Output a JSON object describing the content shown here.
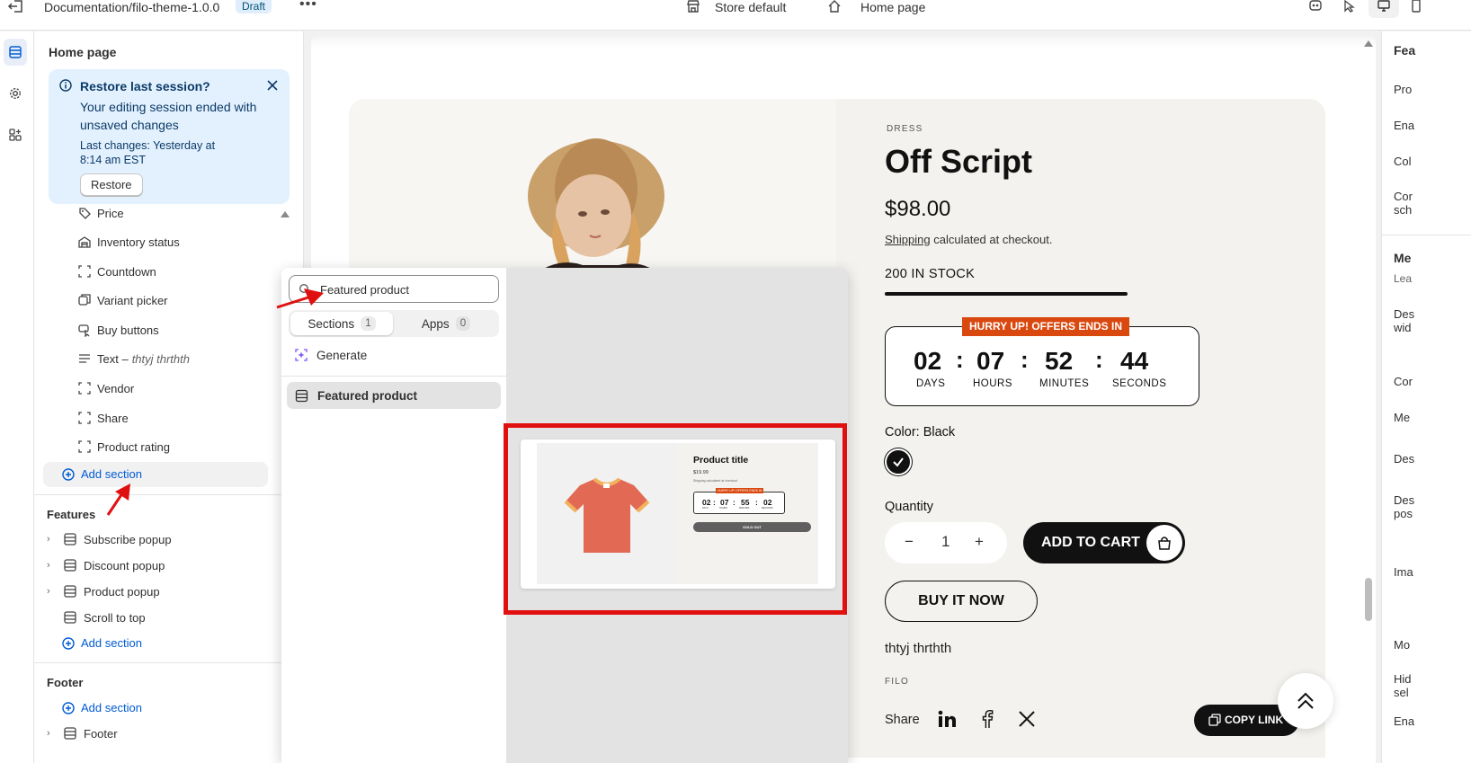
{
  "topbar": {
    "doc_path": "Documentation/filo-theme-1.0.0",
    "status_badge": "Draft",
    "more_label": "•••",
    "store_selector": "Store default",
    "page_selector": "Home page"
  },
  "sidebar": {
    "title": "Home page",
    "banner": {
      "title": "Restore last session?",
      "message": "Your editing session ended with unsaved changes",
      "meta": "Last changes: Yesterday at 8:14 am EST",
      "restore_label": "Restore"
    },
    "blocks": [
      {
        "label": "Price",
        "icon": "price-tag-icon"
      },
      {
        "label": "Inventory status",
        "icon": "inventory-icon"
      },
      {
        "label": "Countdown",
        "icon": "block-placeholder-icon"
      },
      {
        "label": "Variant picker",
        "icon": "variant-icon"
      },
      {
        "label": "Buy buttons",
        "icon": "buy-buttons-icon"
      },
      {
        "label": "Text –",
        "sub": "thtyj thrthth",
        "icon": "text-icon"
      },
      {
        "label": "Vendor",
        "icon": "block-placeholder-icon"
      },
      {
        "label": "Share",
        "icon": "block-placeholder-icon"
      },
      {
        "label": "Product rating",
        "icon": "block-placeholder-icon"
      }
    ],
    "add_section_label": "Add section",
    "features": {
      "title": "Features",
      "items": [
        {
          "label": "Subscribe popup"
        },
        {
          "label": "Discount popup"
        },
        {
          "label": "Product popup"
        },
        {
          "label": "Scroll to top"
        }
      ],
      "add_section_label": "Add section"
    },
    "footer": {
      "title": "Footer",
      "add_section_label": "Add section",
      "partial_item": "Footer"
    }
  },
  "popover": {
    "search_value": "Featured product",
    "tabs": [
      {
        "label": "Sections",
        "count": "1"
      },
      {
        "label": "Apps",
        "count": "0"
      }
    ],
    "generate_label": "Generate",
    "result_label": "Featured product",
    "preview": {
      "title": "Product title",
      "price": "$19.99",
      "shipping": "Shipping calculated at checkout",
      "hurry": "HURRY UP! OFFERS ENDS IN",
      "cd_values": [
        "02",
        "07",
        "55",
        "02"
      ],
      "cd_labels": [
        "DAYS",
        "HOURS",
        "MINUTES",
        "SECONDS"
      ],
      "sold_out": "SOLD OUT"
    }
  },
  "product": {
    "vendor_label": "DRESS",
    "title": "Off Script",
    "price": "$98.00",
    "shipping_link": "Shipping",
    "shipping_text": "calculated at checkout.",
    "stock_text": "200 IN STOCK",
    "stock_fill": 1.0,
    "hurry": "HURRY UP! OFFERS ENDS IN",
    "countdown": {
      "days": "02",
      "hours": "07",
      "minutes": "52",
      "seconds": "44",
      "days_label": "DAYS",
      "hours_label": "HOURS",
      "minutes_label": "MINUTES",
      "seconds_label": "SECONDS",
      "sep": ":"
    },
    "color_label": "Color: Black",
    "quantity_label": "Quantity",
    "quantity_value": "1",
    "minus": "−",
    "plus": "+",
    "add_to_cart": "ADD TO CART",
    "buy_now": "BUY IT NOW",
    "description": "thtyj thrthth",
    "brand": "FILO",
    "share_label": "Share",
    "copy_link": "COPY LINK"
  },
  "right_panel": {
    "title": "Fea",
    "items": [
      "Pro",
      "Ena",
      "Col",
      "Cor",
      "sch"
    ],
    "section2_title": "Me",
    "section2_sub": "Lea",
    "items2": [
      "Des",
      "wid",
      "Cor",
      "Me",
      "Des",
      "Des",
      "pos",
      "Ima",
      "Mo",
      "Hid",
      "sel",
      "Ena"
    ]
  },
  "colors": {
    "accent_blue": "#005bd3",
    "banner_bg": "#e3f1ff",
    "hurry_orange": "#d9480f",
    "highlight_red": "#e01010"
  }
}
